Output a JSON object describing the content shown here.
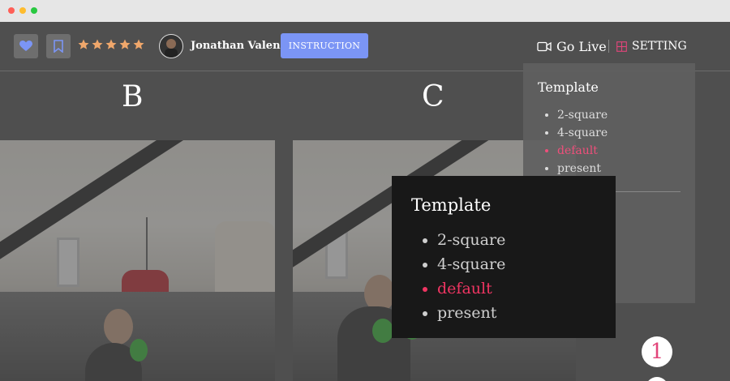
{
  "window_controls": {
    "close_color": "#ff5f57",
    "minimize_color": "#febc2e",
    "maximize_color": "#28c840"
  },
  "toolbar": {
    "heart_icon": "heart-icon",
    "bookmark_icon": "bookmark-icon",
    "rating": 5,
    "star_color": "#f0a76b",
    "user_name": "Jonathan Valencia",
    "instruction_label": "INSTRUCTION",
    "go_live_label": "Go Live",
    "setting_label": "SETTING",
    "accent": "#7b95f5"
  },
  "columns": {
    "b_label": "B",
    "c_label": "C"
  },
  "settings_panel": {
    "title": "Template",
    "options": [
      "2-square",
      "4-square",
      "default",
      "present"
    ],
    "selected": "default",
    "selected_color": "#ef4f7b"
  },
  "tooltip": {
    "title": "Template",
    "options": [
      "2-square",
      "4-square",
      "default",
      "present"
    ],
    "selected": "default",
    "selected_color": "#ef3562"
  },
  "page_indicator": {
    "current": "1",
    "color": "#e2457a"
  }
}
